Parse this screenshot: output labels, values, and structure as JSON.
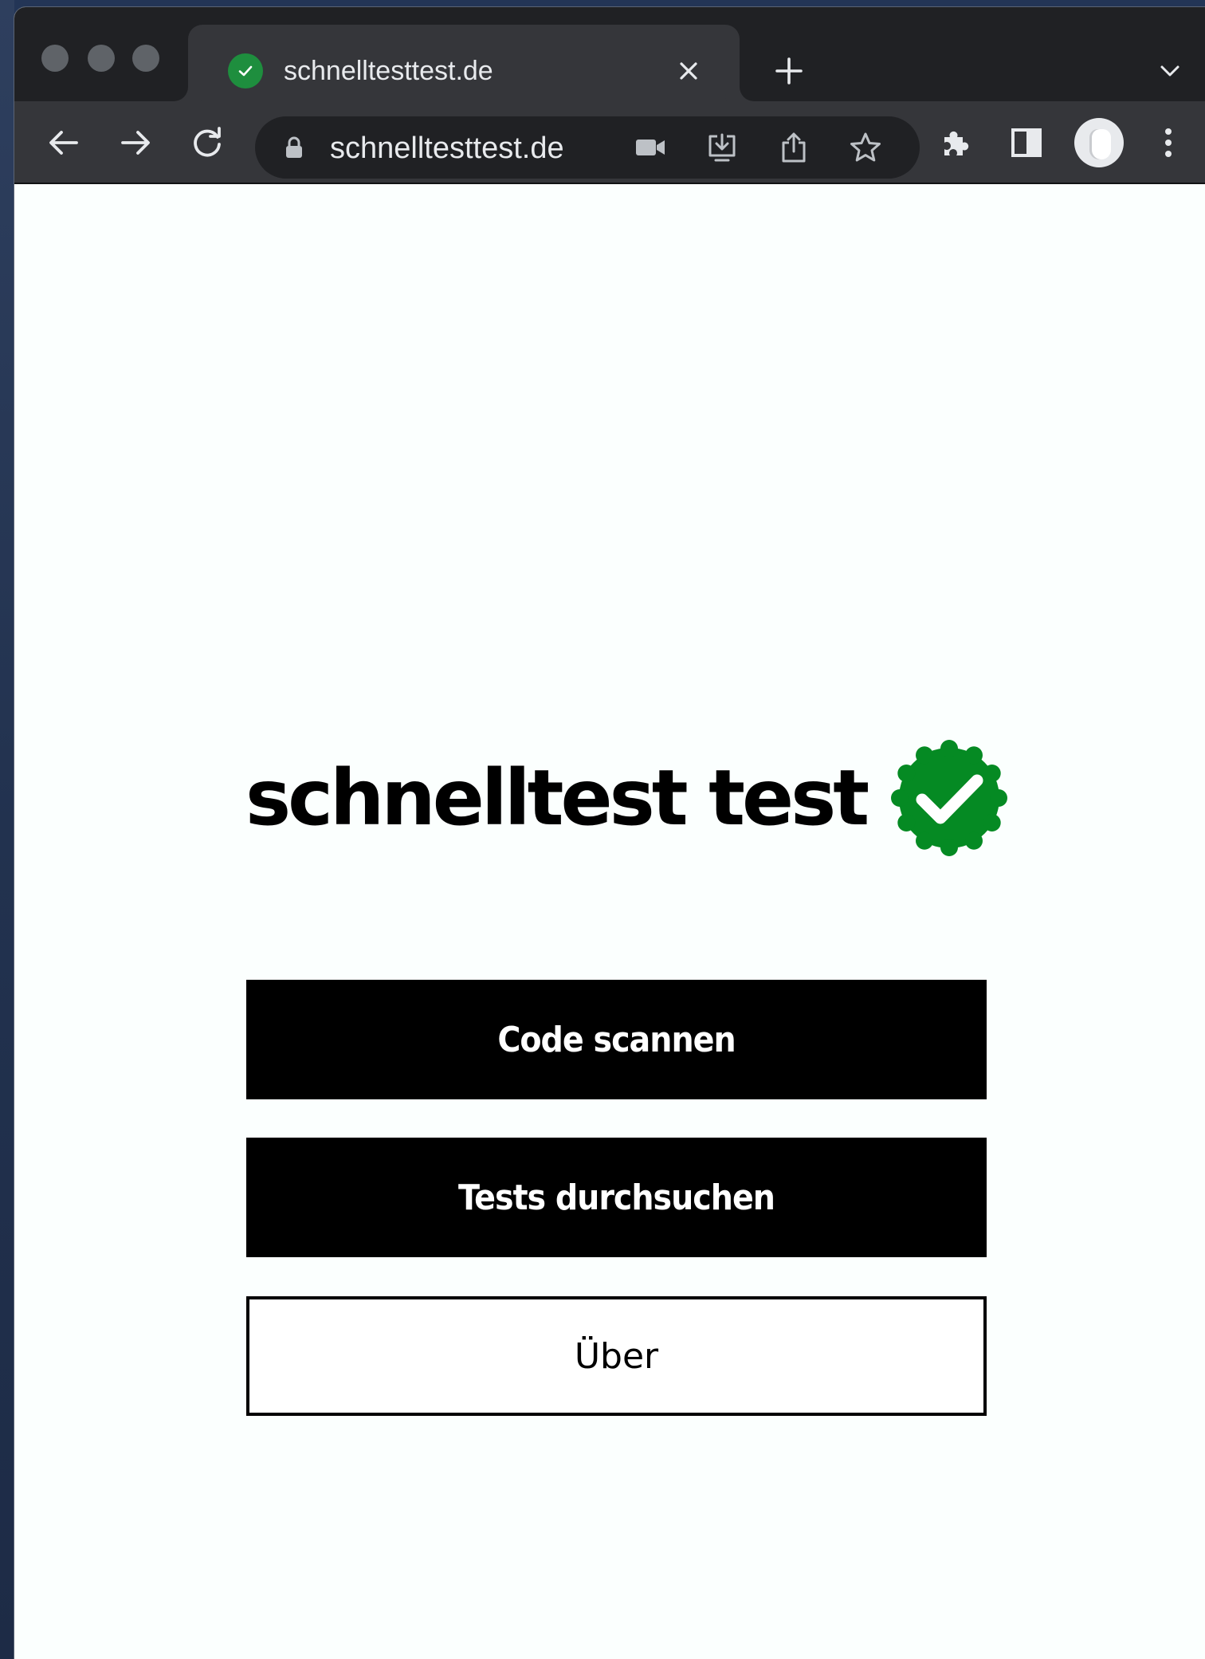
{
  "browser": {
    "tab": {
      "title": "schnelltesttest.de",
      "favicon_icon": "green-check-circle-icon"
    },
    "toolbar": {
      "url": "schnelltesttest.de"
    }
  },
  "page": {
    "logo": {
      "text": "schnelltest test",
      "badge_icon": "verified-check-badge-icon",
      "badge_color": "#058a23"
    },
    "buttons": {
      "scan_label": "Code scannen",
      "search_label": "Tests durchsuchen",
      "about_label": "Über"
    }
  },
  "colors": {
    "tab_strip": "#202124",
    "toolbar": "#35363a",
    "page_background": "#fbfffe",
    "primary_button": "#000000",
    "accent_green": "#058a23"
  }
}
